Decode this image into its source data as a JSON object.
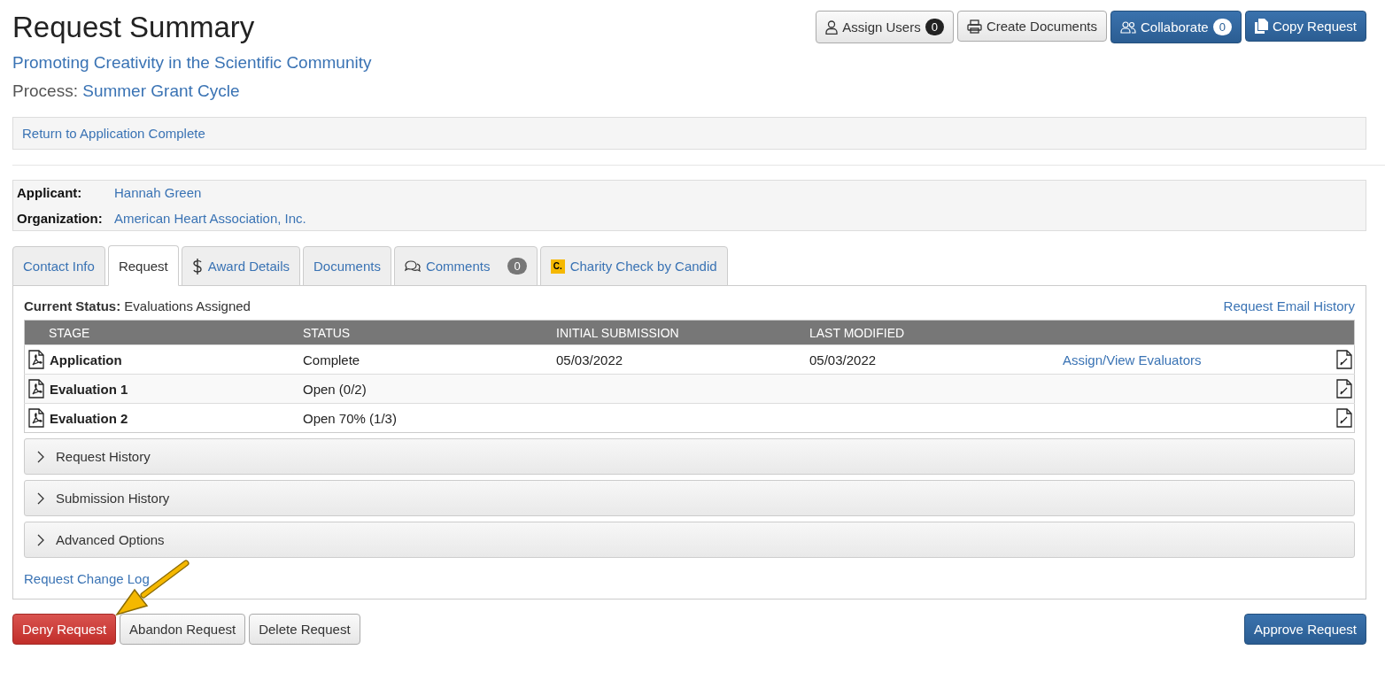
{
  "page": {
    "title": "Request Summary",
    "subtitle": "Promoting Creativity in the Scientific Community",
    "process_label": "Process:",
    "process": "Summer Grant Cycle"
  },
  "header_buttons": [
    {
      "label": "Assign Users",
      "kind": "default",
      "badge": "0"
    },
    {
      "label": "Create Documents",
      "kind": "default"
    },
    {
      "label": "Collaborate",
      "kind": "primary",
      "badge": "0"
    },
    {
      "label": "Copy Request",
      "kind": "primary"
    }
  ],
  "return_link": "Return to Application Complete",
  "applicant": [
    {
      "label": "Applicant:",
      "value": "Hannah Green"
    },
    {
      "label": "Organization:",
      "value": "American Heart Association, Inc."
    }
  ],
  "tabs": [
    {
      "label": "Contact Info",
      "selected": false
    },
    {
      "label": "Request",
      "selected": true
    },
    {
      "label": "Award Details",
      "selected": false
    },
    {
      "label": "Documents",
      "selected": false
    },
    {
      "label": "Comments",
      "selected": false,
      "badge": "0"
    },
    {
      "label": "Charity Check by Candid",
      "selected": false,
      "logo_text": "C."
    }
  ],
  "status": {
    "label": "Current Status:",
    "value": "Evaluations Assigned"
  },
  "email_history": "Request Email History",
  "table": {
    "columns": [
      "STAGE",
      "STATUS",
      "INITIAL SUBMISSION",
      "LAST MODIFIED"
    ],
    "rows": [
      {
        "stage": "Application",
        "status": "Complete",
        "initial_submission": "05/03/2022",
        "last_modified": "05/03/2022",
        "action": "Assign/View Evaluators"
      },
      {
        "stage": "Evaluation 1",
        "status": "Open (0/2)"
      },
      {
        "stage": "Evaluation 2",
        "status": "Open 70% (1/3)"
      }
    ]
  },
  "sections": [
    {
      "label": "Request History",
      "expanded": false
    },
    {
      "label": "Submission History",
      "expanded": false
    },
    {
      "label": "Advanced Options",
      "expanded": false
    }
  ],
  "change_log": "Request Change Log",
  "footer": {
    "left": [
      {
        "label": "Deny Request",
        "kind": "danger"
      },
      {
        "label": "Abandon Request",
        "kind": "default"
      },
      {
        "label": "Delete Request",
        "kind": "default"
      }
    ],
    "right": [
      {
        "label": "Approve Request",
        "kind": "primary"
      }
    ]
  }
}
